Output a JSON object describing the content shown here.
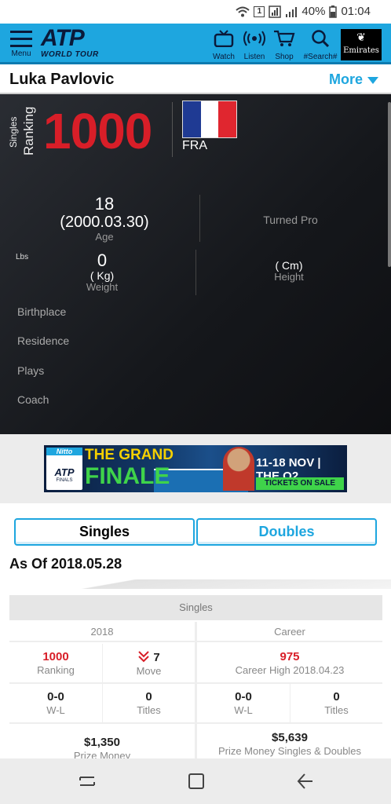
{
  "status_bar": {
    "sim_label": "1",
    "battery": "40%",
    "time": "01:04"
  },
  "header": {
    "menu_label": "Menu",
    "logo_main": "ATP",
    "logo_sub": "WORLD TOUR",
    "nav": [
      {
        "label": "Watch",
        "icon": "tv-icon"
      },
      {
        "label": "Listen",
        "icon": "radio-icon"
      },
      {
        "label": "Shop",
        "icon": "cart-icon"
      },
      {
        "label": "#Search#",
        "icon": "search-icon"
      }
    ],
    "sponsor": "Emirates",
    "accent": "#1ea6df"
  },
  "player": {
    "name": "Luka Pavlovic",
    "more_label": "More",
    "ranking_small": "Singles",
    "ranking_big": "Ranking",
    "ranking": "1000",
    "country": "FRA",
    "age": "18",
    "birth_date": "(2000.03.30)",
    "age_label": "Age",
    "turned_pro_label": "Turned Pro",
    "lbs_label": "Lbs",
    "weight_value": "0",
    "weight_kg": "( Kg)",
    "weight_label": "Weight",
    "height_cm": "( Cm)",
    "height_label": "Height",
    "birthplace_label": "Birthplace",
    "residence_label": "Residence",
    "plays_label": "Plays",
    "coach_label": "Coach"
  },
  "ad": {
    "brand": "Nitto",
    "logo": "ATP",
    "logo_sub": "FINALS",
    "title_line1": "THE GRAND",
    "title_line2": "FINALE",
    "dates": "11-18 NOV | THE O2",
    "cta": "TICKETS ON SALE NOW"
  },
  "tabs": [
    {
      "label": "Singles",
      "active": true
    },
    {
      "label": "Doubles",
      "active": false
    }
  ],
  "as_of": "As Of 2018.05.28",
  "stats": {
    "section": "Singles",
    "year_header": "2018",
    "career_header": "Career",
    "year": {
      "ranking": "1000",
      "ranking_label": "Ranking",
      "move": "7",
      "move_label": "Move",
      "wl": "0-0",
      "wl_label": "W-L",
      "titles": "0",
      "titles_label": "Titles",
      "prize": "$1,350",
      "prize_label": "Prize Money"
    },
    "career": {
      "high": "975",
      "high_label": "Career High 2018.04.23",
      "wl": "0-0",
      "wl_label": "W-L",
      "titles": "0",
      "titles_label": "Titles",
      "prize": "$5,639",
      "prize_label": "Prize Money Singles & Doubles"
    }
  }
}
